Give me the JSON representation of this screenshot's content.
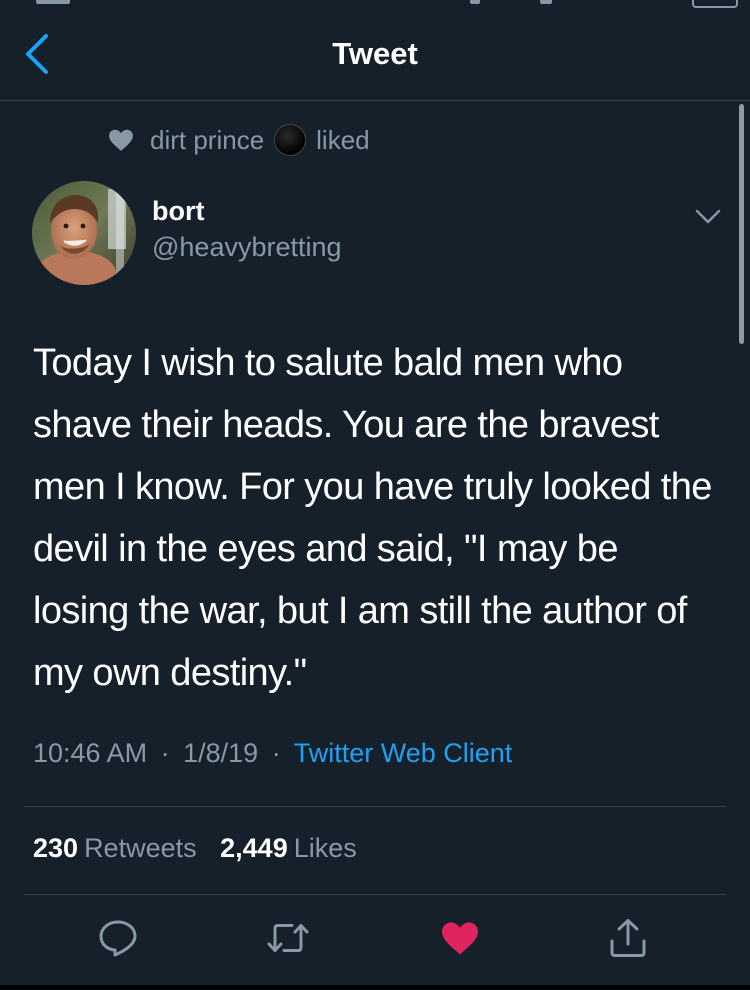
{
  "navbar": {
    "title": "Tweet",
    "back_icon": "chevron-left-icon"
  },
  "social_context": {
    "icon": "heart-icon",
    "name": "dirt prince",
    "action": "liked"
  },
  "author": {
    "display_name": "bort",
    "handle": "@heavybretting"
  },
  "tweet": {
    "text": "Today I wish to salute bald men who shave their heads. You are the bravest men I know. For you have truly looked the devil in the eyes and said, \"I may be losing the war, but I am still the author of my own destiny.\"",
    "time": "10:46 AM",
    "date": "1/8/19",
    "separator": "·",
    "client": "Twitter Web Client"
  },
  "stats": {
    "retweets_count": "230",
    "retweets_label": "Retweets",
    "likes_count": "2,449",
    "likes_label": "Likes"
  },
  "actions": {
    "reply_icon": "reply-icon",
    "retweet_icon": "retweet-icon",
    "like_icon": "heart-filled-icon",
    "share_icon": "share-icon",
    "liked": true
  },
  "colors": {
    "background": "#15202b",
    "accent": "#1da1f2",
    "secondary_text": "#8899a6",
    "like": "#e0245e",
    "divider": "#38444d"
  }
}
